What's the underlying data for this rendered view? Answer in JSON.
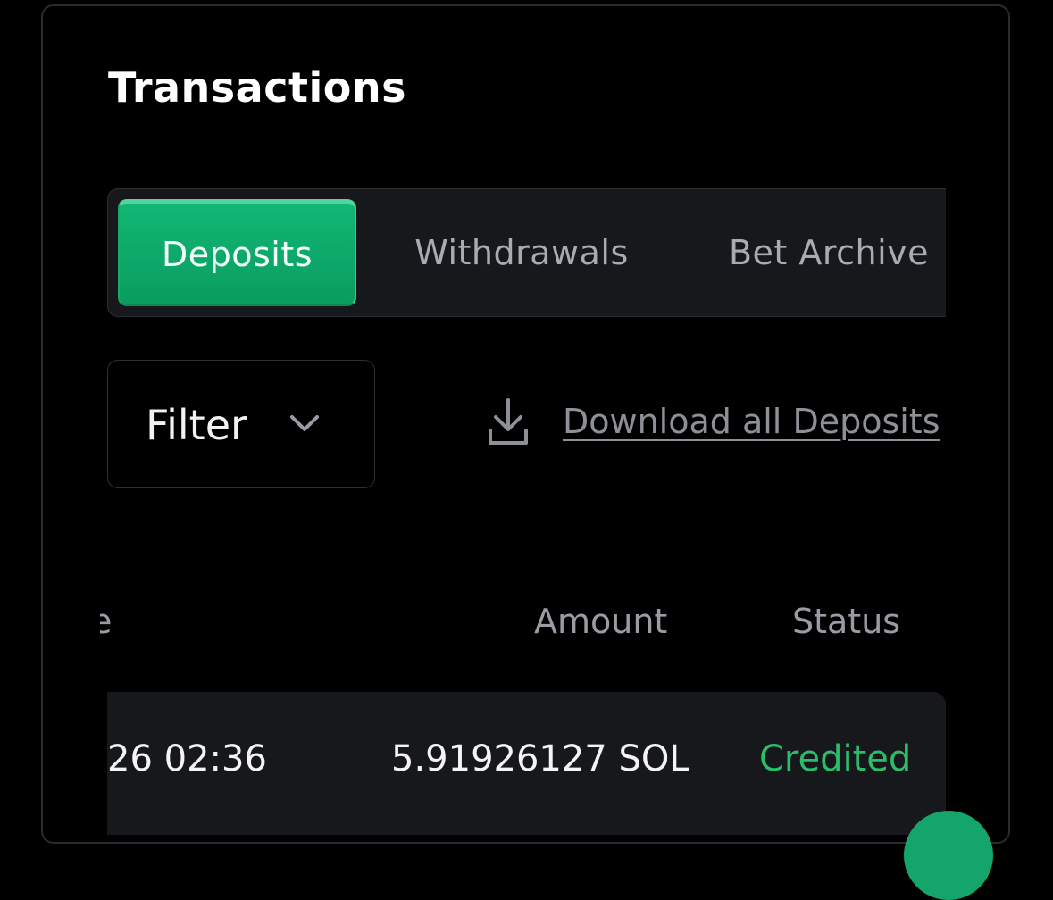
{
  "page": {
    "title": "Transactions"
  },
  "tabs": [
    {
      "label": "Deposits",
      "active": true
    },
    {
      "label": "Withdrawals",
      "active": false
    },
    {
      "label": "Bet Archive",
      "active": false
    }
  ],
  "filter": {
    "label": "Filter",
    "icon": "chevron-down-icon"
  },
  "download": {
    "label": "Download all Deposits",
    "icon": "download-icon"
  },
  "table": {
    "columns": [
      "e",
      "Amount",
      "Status"
    ],
    "rows": [
      {
        "date": "26 02:36",
        "amount": "5.91926127 SOL",
        "status": "Credited"
      }
    ]
  },
  "colors": {
    "accent": "#10b774",
    "credited": "#2cbd6a",
    "panel_bg": "#17181c"
  }
}
